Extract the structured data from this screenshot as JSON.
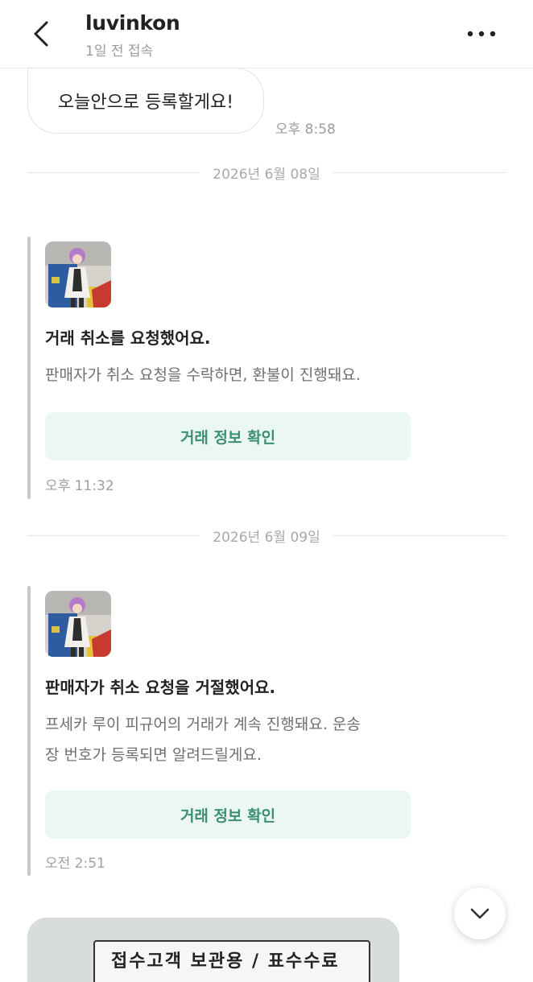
{
  "header": {
    "username": "luvinkon",
    "status": "1일 전 접속"
  },
  "messages": {
    "bubble_text": "오늘안으로 등록할게요!",
    "bubble_time": "오후 8:58"
  },
  "dates": {
    "first": "2026년 6월 08일",
    "second": "2026년 6월 09일"
  },
  "cards": [
    {
      "title": "거래 취소를 요청했어요.",
      "body": "판매자가 취소 요청을 수락하면, 환불이 진행돼요.",
      "button": "거래 정보 확인",
      "time": "오후 11:32"
    },
    {
      "title": "판매자가 취소 요청을 거절했어요.",
      "body_line1": "프세카 루이 피규어의 거래가 계속 진행돼요. 운송",
      "body_line2": "장 번호가 등록되면 알려드릴게요.",
      "button": "거래 정보 확인",
      "time": "오전 2:51"
    }
  ],
  "photo": {
    "label_text": "접수고객 보관용 / 표수수료"
  },
  "icons": {
    "back": "chevron-left-icon",
    "more": "more-horizontal-icon",
    "scroll": "chevron-down-icon"
  },
  "colors": {
    "accent_text": "#3c8f72",
    "accent_bg": "#ebf7f2"
  }
}
